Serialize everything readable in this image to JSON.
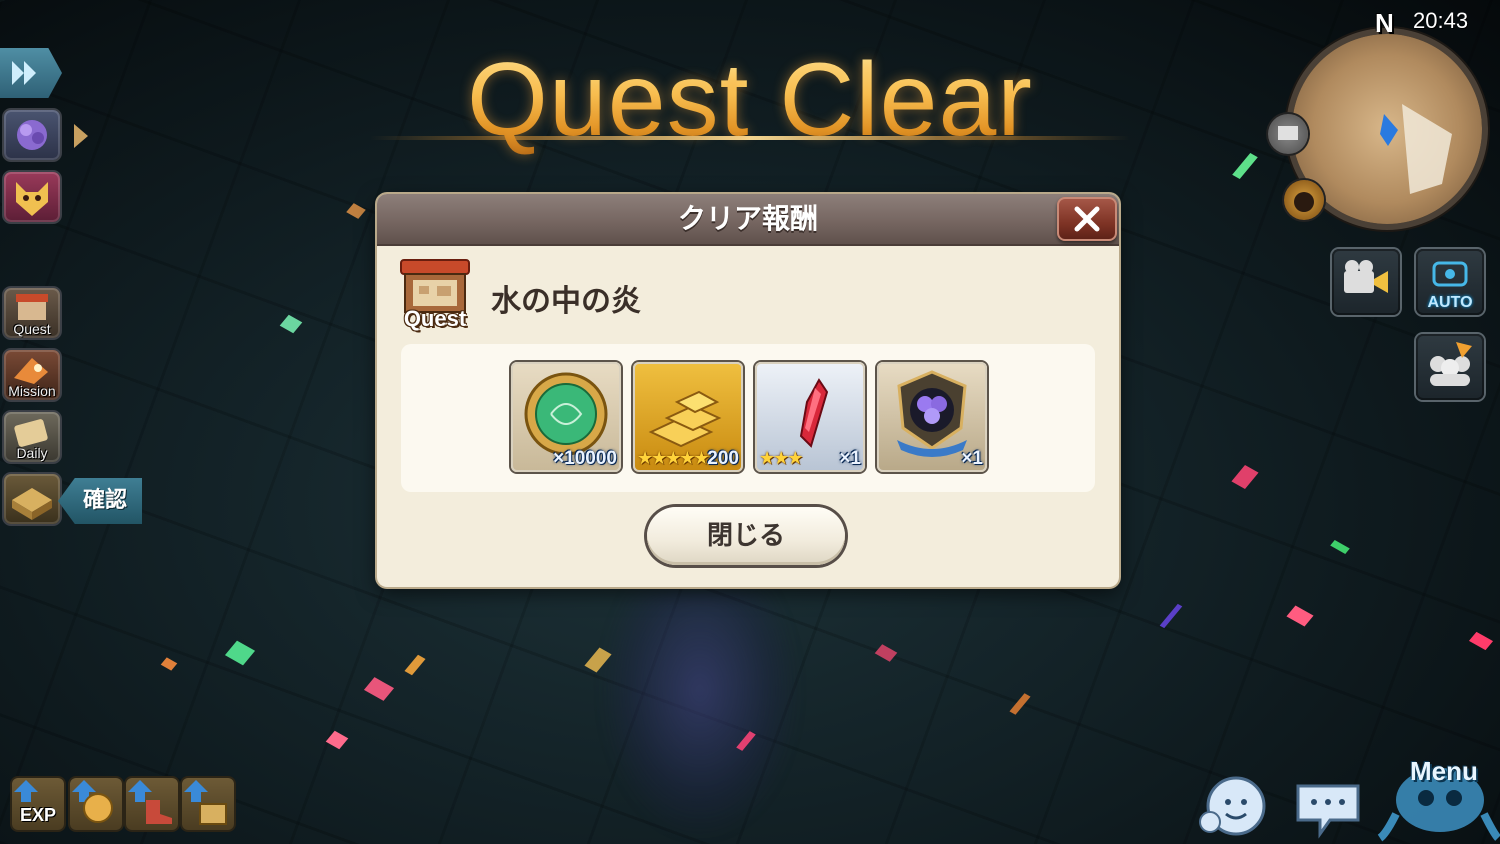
{
  "header": {
    "title": "Quest Clear"
  },
  "dialog": {
    "title": "クリア報酬",
    "quest_label": "Quest",
    "quest_name": "水の中の炎",
    "close_button_label": "閉じる",
    "rewards": [
      {
        "icon": "medal-coin-icon",
        "quantity": "×10000",
        "stars": ""
      },
      {
        "icon": "gold-bars-icon",
        "quantity": "200",
        "stars": "★★★★★"
      },
      {
        "icon": "red-crystal-icon",
        "quantity": "×1",
        "stars": "★★★"
      },
      {
        "icon": "purple-flower-emblem-icon",
        "quantity": "×1",
        "stars": ""
      }
    ]
  },
  "sidebar": {
    "items": [
      {
        "label": "",
        "icon": "purple-gem-icon"
      },
      {
        "label": "",
        "icon": "fox-mask-icon"
      },
      {
        "label": "Quest",
        "icon": "quest-shop-icon"
      },
      {
        "label": "Mission",
        "icon": "mission-bird-icon"
      },
      {
        "label": "Daily",
        "icon": "daily-scroll-icon"
      },
      {
        "label": "",
        "icon": "gift-box-icon"
      }
    ],
    "confirm_label": "確認"
  },
  "bottom_left": {
    "items": [
      {
        "label": "EXP",
        "icon": "exp-up-icon"
      },
      {
        "label": "",
        "icon": "coin-up-icon"
      },
      {
        "label": "",
        "icon": "boot-up-icon"
      },
      {
        "label": "",
        "icon": "basket-up-icon"
      }
    ]
  },
  "top_right": {
    "clock": "20:43",
    "compass_label": "N",
    "auto_label": "AUTO"
  },
  "bottom_right": {
    "menu_label": "Menu"
  },
  "colors": {
    "dialog_bg": "#f3eddc",
    "header_bg": "#74645f",
    "title_gold": "#f4c060",
    "close_red": "#7e3325"
  }
}
